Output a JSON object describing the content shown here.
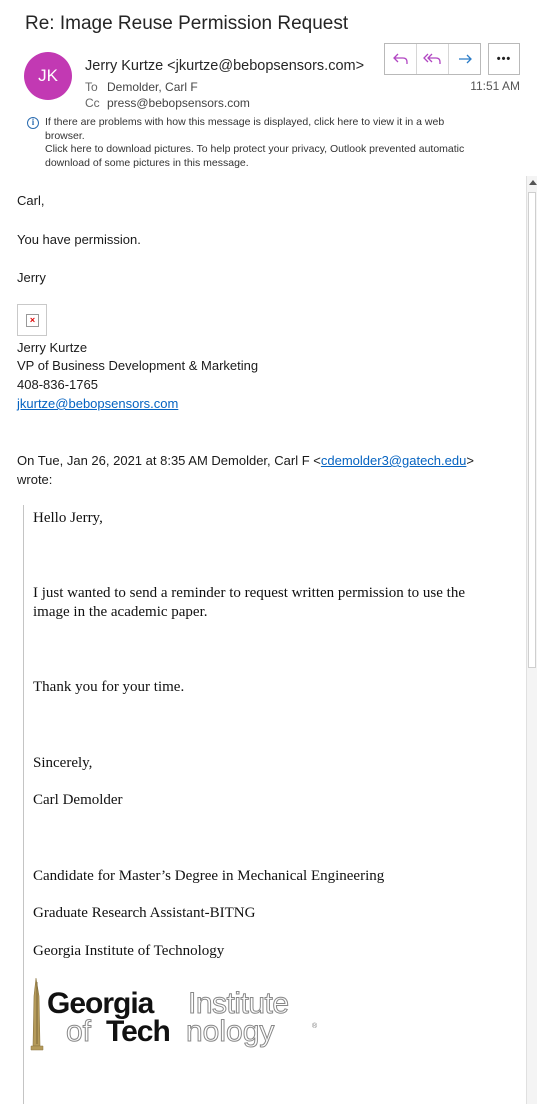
{
  "message": {
    "subject": "Re: Image Reuse Permission Request",
    "avatar_initials": "JK",
    "avatar_color": "#c239b3",
    "from": "Jerry Kurtze <jkurtze@bebopsensors.com>",
    "to_label": "To",
    "to": "Demolder, Carl F",
    "cc_label": "Cc",
    "cc": "press@bebopsensors.com",
    "time": "11:51 AM"
  },
  "actions": {
    "reply_icon": "reply-icon",
    "reply_all_icon": "reply-all-icon",
    "forward_icon": "forward-icon",
    "more_icon": "more-icon",
    "more_label": "•••"
  },
  "info": {
    "line1": "If there are problems with how this message is displayed, click here to view it in a web",
    "line2": "browser.",
    "line3": "Click here to download pictures. To help protect your privacy, Outlook prevented automatic",
    "line4": "download of some pictures in this message."
  },
  "reply": {
    "greeting": "Carl,",
    "line1": "You have permission.",
    "signoff": "Jerry",
    "sig_name": "Jerry Kurtze",
    "sig_title": "VP of Business Development & Marketing",
    "sig_phone": "408-836-1765",
    "sig_email": "jkurtze@bebopsensors.com"
  },
  "quote_header": {
    "prefix": "On Tue, Jan 26, 2021 at 8:35 AM Demolder, Carl F <",
    "email": "cdemolder3@gatech.edu",
    "suffix": ">",
    "wrote": "wrote:"
  },
  "quoted": {
    "greeting": "Hello Jerry,",
    "para1_line1": "I just wanted to send a reminder to request written permission to use the",
    "para1_line2": "image in the academic paper.",
    "thanks": "Thank you for your time.",
    "closing": "Sincerely,",
    "name": "Carl Demolder",
    "title1": "Candidate for Master’s Degree in Mechanical Engineering",
    "title2": "Graduate Research Assistant-BITNG",
    "org": "Georgia Institute of Technology"
  },
  "logo": {
    "line1_bold": "Georgia",
    "line1_light": "Institute",
    "line2_light": "of",
    "line2_bold": "Tech",
    "line2_light2": "nology",
    "mark": "®"
  }
}
